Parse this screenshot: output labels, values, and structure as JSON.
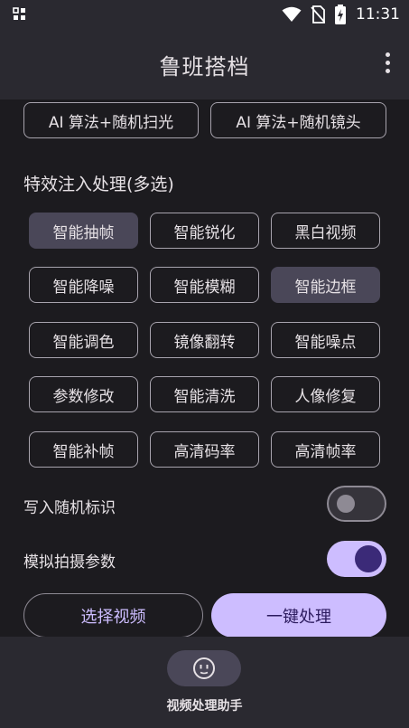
{
  "status_bar": {
    "time": "11:31"
  },
  "app_bar": {
    "title": "鲁班搭档"
  },
  "top_buttons": [
    {
      "label": "AI 算法+随机扫光"
    },
    {
      "label": "AI 算法+随机镜头"
    }
  ],
  "effects": {
    "title": "特效注入处理(多选)",
    "options": [
      {
        "label": "智能抽帧",
        "selected": true
      },
      {
        "label": "智能锐化",
        "selected": false
      },
      {
        "label": "黑白视频",
        "selected": false
      },
      {
        "label": "智能降噪",
        "selected": false
      },
      {
        "label": "智能模糊",
        "selected": false
      },
      {
        "label": "智能边框",
        "selected": true
      },
      {
        "label": "智能调色",
        "selected": false
      },
      {
        "label": "镜像翻转",
        "selected": false
      },
      {
        "label": "智能噪点",
        "selected": false
      },
      {
        "label": "参数修改",
        "selected": false
      },
      {
        "label": "智能清洗",
        "selected": false
      },
      {
        "label": "人像修复",
        "selected": false
      },
      {
        "label": "智能补帧",
        "selected": false
      },
      {
        "label": "高清码率",
        "selected": false
      },
      {
        "label": "高清帧率",
        "selected": false
      }
    ]
  },
  "toggles": [
    {
      "label": "写入随机标识",
      "on": false
    },
    {
      "label": "模拟拍摄参数",
      "on": true
    }
  ],
  "actions": {
    "select_video": "选择视频",
    "one_click": "一键处理"
  },
  "bottom_nav": {
    "label": "视频处理助手",
    "icon": "face-icon"
  },
  "colors": {
    "background": "#1c1b1f",
    "surface": "#2a2930",
    "accent": "#cdbdff",
    "selected_chip": "#4a4758"
  }
}
